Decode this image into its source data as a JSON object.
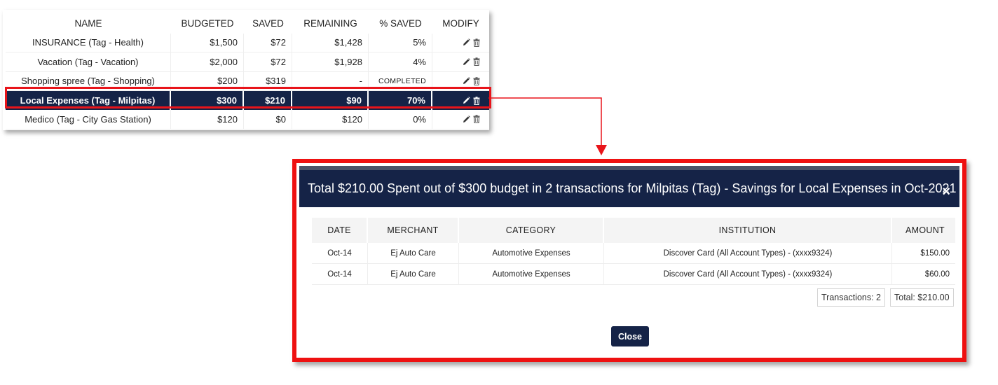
{
  "budget_table": {
    "headers": {
      "name": "NAME",
      "budgeted": "BUDGETED",
      "saved": "SAVED",
      "remaining": "REMAINING",
      "pct_saved": "% SAVED",
      "modify": "MODIFY"
    },
    "rows": [
      {
        "name": "INSURANCE (Tag - Health)",
        "budgeted": "$1,500",
        "saved": "$72",
        "remaining": "$1,428",
        "pct_saved": "5%"
      },
      {
        "name": "Vacation (Tag - Vacation)",
        "budgeted": "$2,000",
        "saved": "$72",
        "remaining": "$1,928",
        "pct_saved": "4%"
      },
      {
        "name": "Shopping spree (Tag - Shopping)",
        "budgeted": "$200",
        "saved": "$319",
        "remaining": "-",
        "pct_saved": "COMPLETED"
      },
      {
        "name": "Local Expenses (Tag - Milpitas)",
        "budgeted": "$300",
        "saved": "$210",
        "remaining": "$90",
        "pct_saved": "70%"
      },
      {
        "name": "Medico (Tag - City Gas Station)",
        "budgeted": "$120",
        "saved": "$0",
        "remaining": "$120",
        "pct_saved": "0%"
      }
    ],
    "selected_row_index": 3,
    "icons": {
      "edit": "pencil-icon",
      "delete": "trash-icon"
    }
  },
  "modal": {
    "title": "Total $210.00 Spent out of $300 budget in 2 transactions for Milpitas (Tag) - Savings for Local Expenses in Oct-2021",
    "close_icon": "×",
    "table": {
      "headers": {
        "date": "DATE",
        "merchant": "MERCHANT",
        "category": "CATEGORY",
        "institution": "INSTITUTION",
        "amount": "AMOUNT"
      },
      "rows": [
        {
          "date": "Oct-14",
          "merchant": "Ej Auto Care",
          "category": "Automotive Expenses",
          "institution": "Discover Card (All Account Types) - (xxxx9324)",
          "amount": "$150.00"
        },
        {
          "date": "Oct-14",
          "merchant": "Ej Auto Care",
          "category": "Automotive Expenses",
          "institution": "Discover Card (All Account Types) - (xxxx9324)",
          "amount": "$60.00"
        }
      ]
    },
    "transactions_count": "Transactions: 2",
    "total": "Total: $210.00",
    "close_button_label": "Close"
  },
  "colors": {
    "navy": "#152347",
    "highlight_red": "#e8141a",
    "modal_border_red": "#ee1111"
  }
}
